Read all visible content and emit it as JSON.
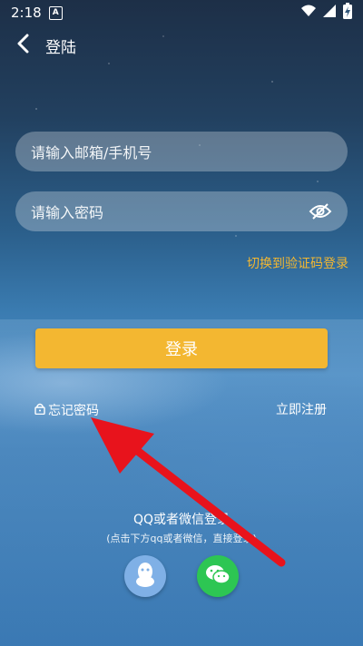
{
  "status_bar": {
    "time": "2:18",
    "notification_icon": "a-badge-icon",
    "icons": [
      "wifi-icon",
      "signal-icon",
      "battery-charging-icon"
    ]
  },
  "header": {
    "title": "登陆",
    "back_icon": "chevron-left-icon"
  },
  "form": {
    "account_placeholder": "请输入邮箱/手机号",
    "password_placeholder": "请输入密码",
    "password_toggle_icon": "eye-off-icon",
    "switch_link": "切换到验证码登录",
    "login_button": "登录",
    "forgot_password": "忘记密码",
    "register": "立即注册"
  },
  "social": {
    "title": "QQ或者微信登录",
    "subtitle": "(点击下方qq或者微信，直接登录)",
    "buttons": [
      "qq-icon",
      "wechat-icon"
    ]
  },
  "colors": {
    "accent": "#f3b731",
    "qq_bg": "#7fb0e6",
    "wechat_bg": "#2dc653",
    "annotation_arrow": "#e8131c"
  }
}
